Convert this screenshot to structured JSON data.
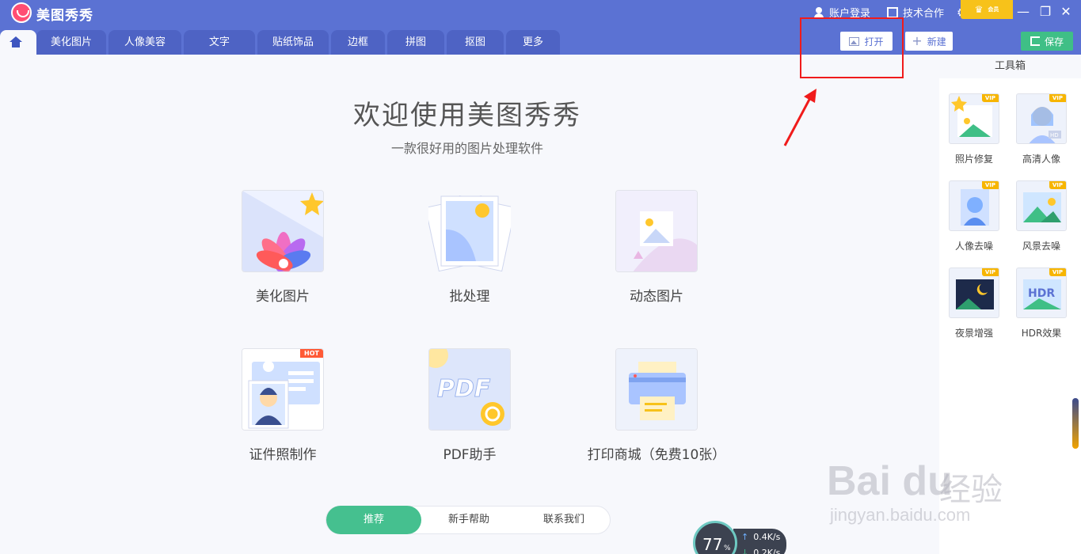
{
  "app": {
    "title": "美图秀秀"
  },
  "top_links": {
    "login": "账户登录",
    "cooperate": "技术合作",
    "settings": "设置"
  },
  "tabs": [
    {
      "label": "美化图片"
    },
    {
      "label": "人像美容"
    },
    {
      "label": "文字"
    },
    {
      "label": "贴纸饰品"
    },
    {
      "label": "边框"
    },
    {
      "label": "拼图"
    },
    {
      "label": "抠图"
    },
    {
      "label": "更多"
    }
  ],
  "toolbar": {
    "open": "打开",
    "new": "新建",
    "vip": "会员",
    "save": "保存"
  },
  "welcome": {
    "title": "欢迎使用美图秀秀",
    "subtitle": "一款很好用的图片处理软件"
  },
  "features": [
    {
      "label": "美化图片"
    },
    {
      "label": "批处理"
    },
    {
      "label": "动态图片"
    },
    {
      "label": "证件照制作",
      "badge": "HOT"
    },
    {
      "label": "PDF助手",
      "art_text": "PDF"
    },
    {
      "label": "打印商城（免费10张）"
    }
  ],
  "bottom_tabs": {
    "recommend": "推荐",
    "help": "新手帮助",
    "contact": "联系我们"
  },
  "speed_widget": {
    "percent": "77",
    "percent_unit": "%",
    "up": "0.4K/s",
    "down": "0.2K/s"
  },
  "toolbox": {
    "title": "工具箱",
    "badge": "VIP",
    "items": [
      {
        "label": "照片修复"
      },
      {
        "label": "高清人像",
        "tag": "HD"
      },
      {
        "label": "人像去噪"
      },
      {
        "label": "风景去噪"
      },
      {
        "label": "夜景增强"
      },
      {
        "label": "HDR效果",
        "tag": "HDR"
      }
    ]
  },
  "watermark": {
    "logo": "Bai du",
    "brand": "经验",
    "url": "jingyan.baidu.com"
  },
  "colors": {
    "brand_blue": "#5b72d3",
    "accent_green": "#45c08f",
    "vip_gold": "#f7c21a",
    "annotation_red": "#f01b1b"
  }
}
